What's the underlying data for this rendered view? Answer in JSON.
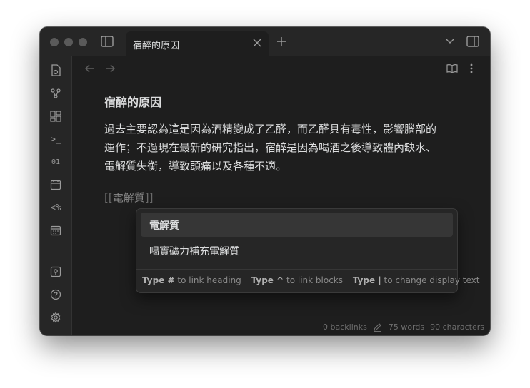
{
  "window": {
    "tab": {
      "title": "宿醉的原因"
    }
  },
  "note": {
    "title": "宿醉的原因",
    "paragraph_line1": "過去主要認為這是因為酒精變成了乙醛，而乙醛具有毒性，影響腦部的",
    "paragraph_line2": "運作；不過現在最新的研究指出，宿醉是因為喝酒之後導致體內缺水、",
    "paragraph_line3": "電解質失衡，導致頭痛以及各種不適。",
    "link_open": "[[",
    "link_text": "電解質",
    "link_close": "]]"
  },
  "suggestions": [
    {
      "label": "電解質",
      "selected": true
    },
    {
      "label": "喝寶礦力補充電解質",
      "selected": false
    }
  ],
  "hints": {
    "h1_key": "Type #",
    "h1_text": "to link heading",
    "h2_key": "Type ^",
    "h2_text": "to link blocks",
    "h3_key": "Type |",
    "h3_text": "to change display text"
  },
  "ribbon": {
    "terminal_label": ">_",
    "binary_label": "01",
    "template_label": "<%"
  },
  "status": {
    "backlinks": "0 backlinks",
    "words": "75 words",
    "characters": "90 characters"
  },
  "colors": {
    "background": "#1e1e1e",
    "panel": "#262626",
    "text": "#dcddde",
    "muted": "#6e6e6e"
  }
}
